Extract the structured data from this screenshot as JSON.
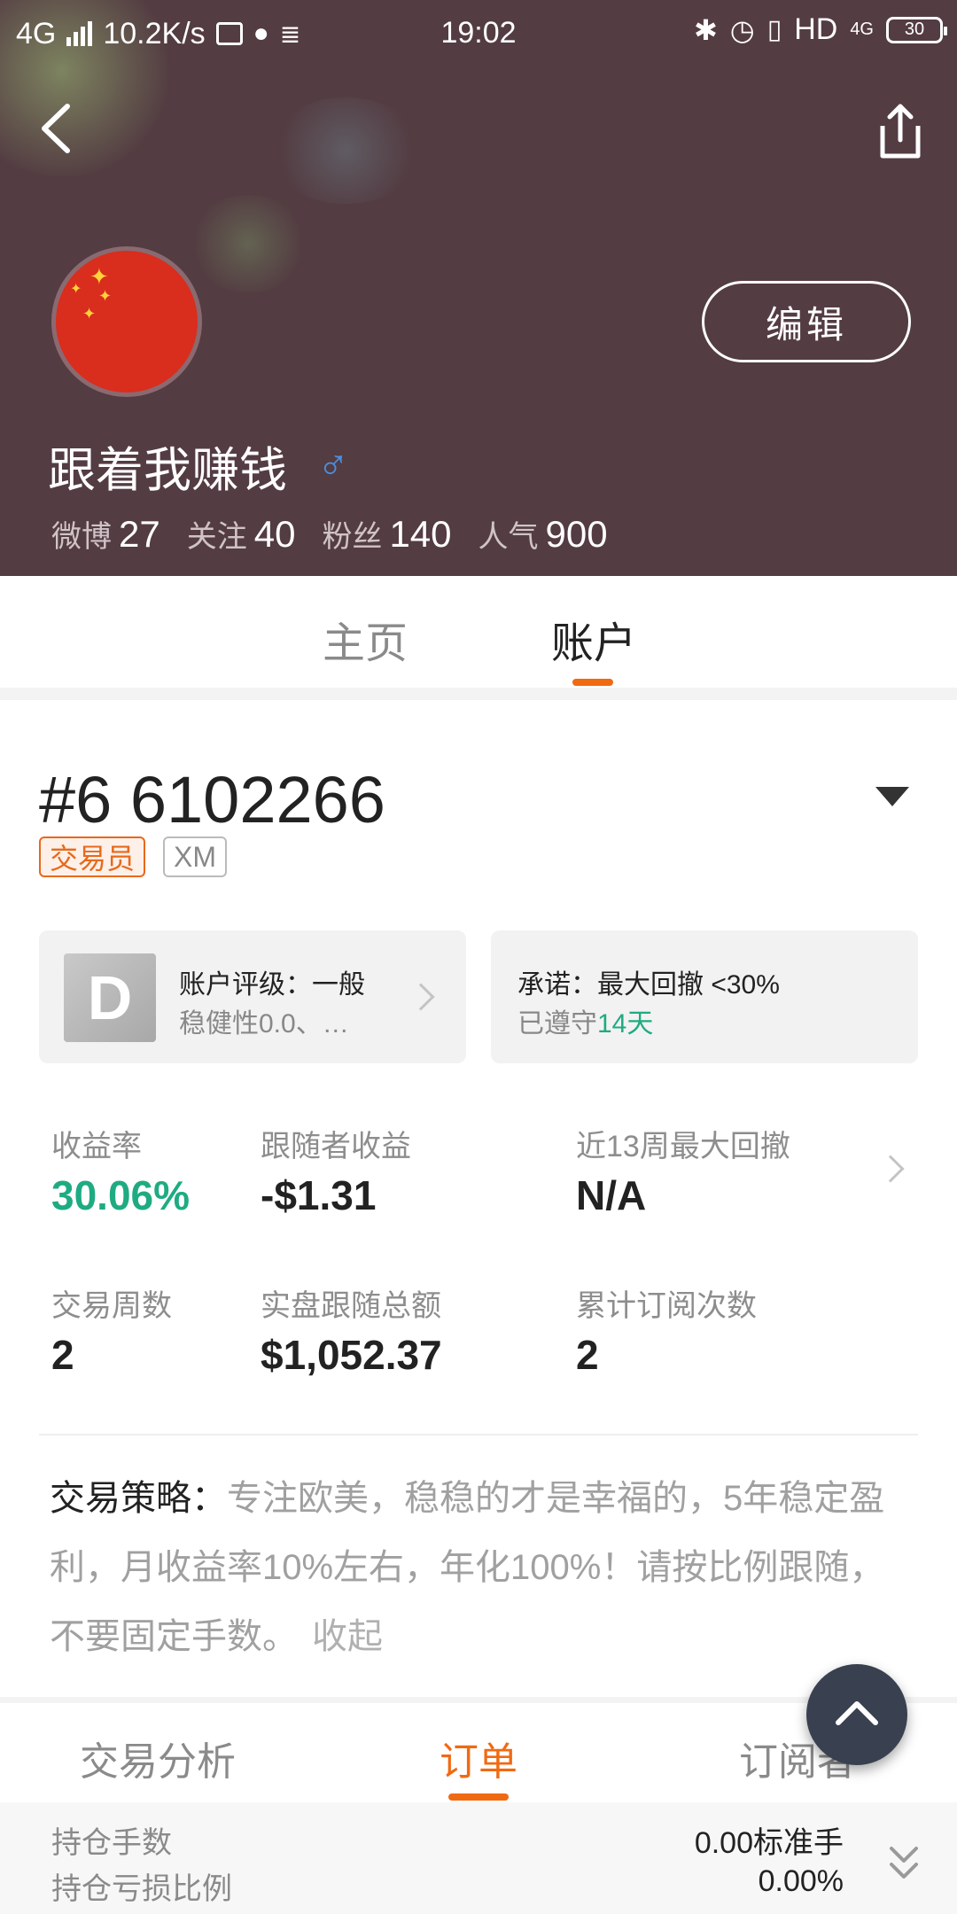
{
  "status_bar": {
    "network": "4G",
    "speed": "10.2K/s",
    "time": "19:02",
    "hd": "HD",
    "signal_4g": "4G",
    "battery": "30"
  },
  "profile": {
    "username": "跟着我赚钱",
    "gender_symbol": "♂",
    "edit_label": "编辑",
    "stats": [
      {
        "label": "微博",
        "value": "27"
      },
      {
        "label": "关注",
        "value": "40"
      },
      {
        "label": "粉丝",
        "value": "140"
      },
      {
        "label": "人气",
        "value": "900"
      }
    ]
  },
  "tabs": [
    {
      "label": "主页",
      "active": false
    },
    {
      "label": "账户",
      "active": true
    }
  ],
  "account": {
    "number": "#6 6102266",
    "badges": [
      "交易员",
      "XM"
    ],
    "rating_grade": "D",
    "rating_title": "账户评级：一般",
    "rating_sub": "稳健性0.0、…",
    "promise_title": "承诺：最大回撤 <30%",
    "promise_prefix": "已遵守",
    "promise_days": "14天"
  },
  "metrics": [
    {
      "label": "收益率",
      "value": "30.06%"
    },
    {
      "label": "跟随者收益",
      "value": "-$1.31"
    },
    {
      "label": "近13周最大回撤",
      "value": "N/A"
    },
    {
      "label": "交易周数",
      "value": "2"
    },
    {
      "label": "实盘跟随总额",
      "value": "$1,052.37"
    },
    {
      "label": "累计订阅次数",
      "value": "2"
    }
  ],
  "strategy": {
    "label": "交易策略：",
    "text": "专注欧美，稳稳的才是幸福的，5年稳定盈利，月收益率10%左右，年化100%！请按比例跟随，不要固定手数。",
    "collapse": "收起"
  },
  "subtabs": [
    {
      "label": "交易分析",
      "active": false
    },
    {
      "label": "订单",
      "active": true
    },
    {
      "label": "订阅者",
      "active": false
    }
  ],
  "positions": [
    {
      "label": "持仓手数",
      "value": "0.00标准手"
    },
    {
      "label": "持仓亏损比例",
      "value": "0.00%"
    }
  ],
  "colors": {
    "accent": "#f06a12",
    "positive": "#1fab82",
    "header_bg": "#533c42"
  }
}
